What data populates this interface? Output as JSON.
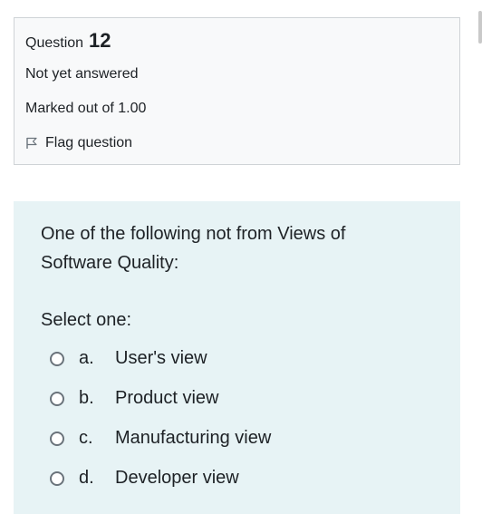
{
  "info": {
    "question_label": "Question",
    "question_number": "12",
    "state": "Not yet answered",
    "grade": "Marked out of 1.00",
    "flag_label": "Flag question"
  },
  "question": {
    "text": "One of the following not from Views of Software Quality:",
    "prompt": "Select one:",
    "options": [
      {
        "letter": "a.",
        "text": "User's view"
      },
      {
        "letter": "b.",
        "text": "Product view"
      },
      {
        "letter": "c.",
        "text": "Manufacturing view"
      },
      {
        "letter": "d.",
        "text": "Developer view"
      }
    ]
  }
}
